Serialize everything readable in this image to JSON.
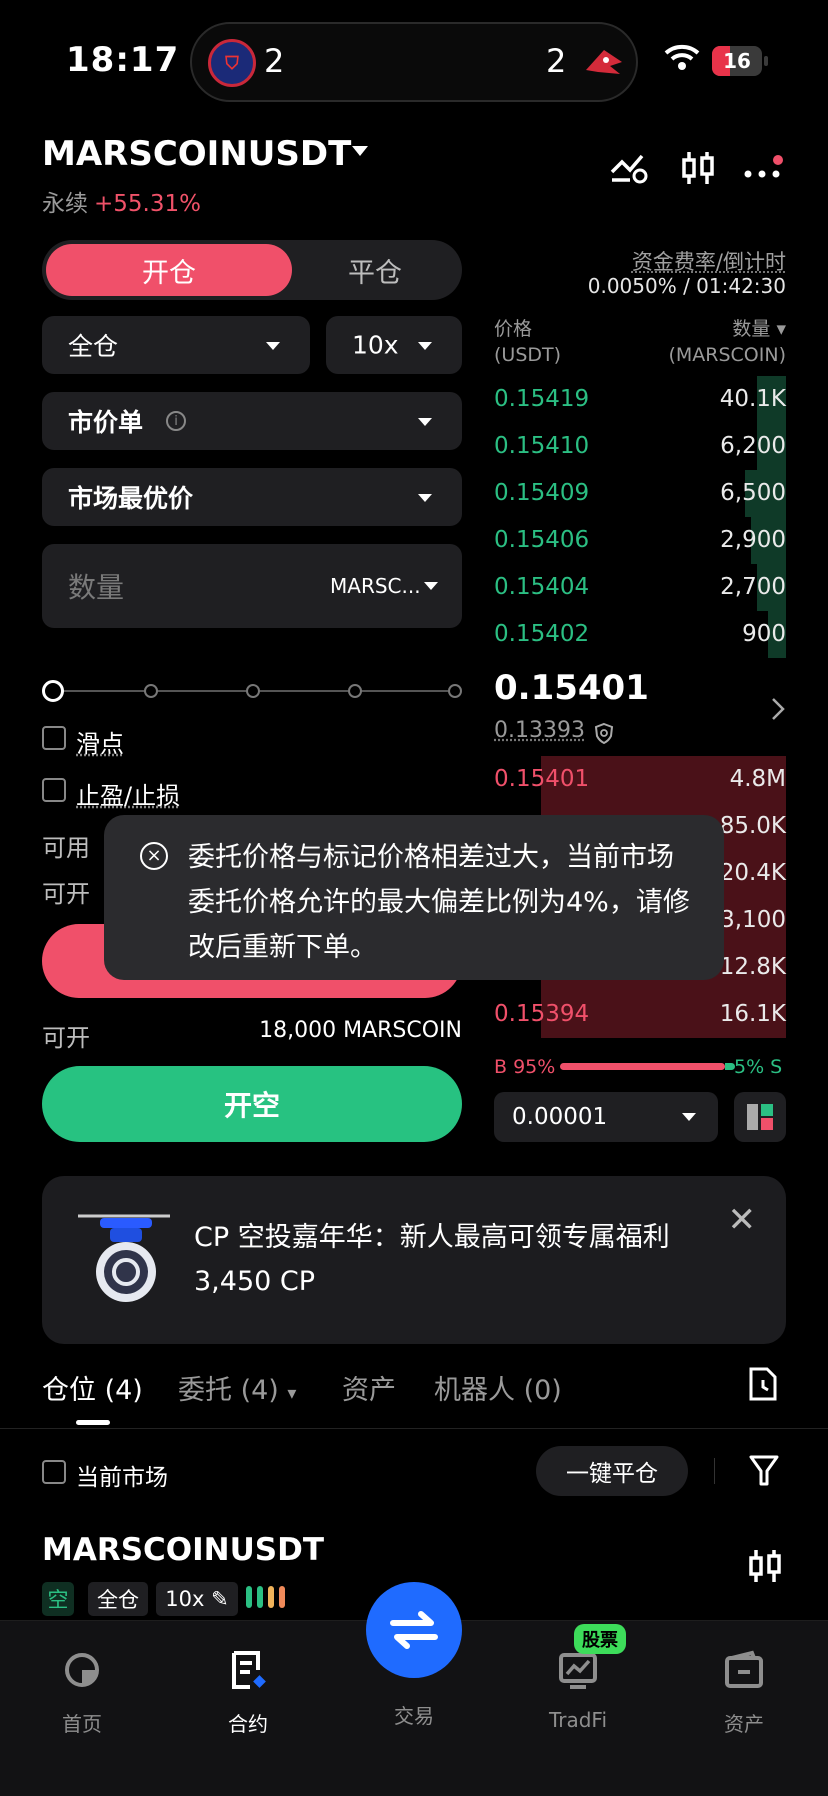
{
  "status": {
    "time": "18:17",
    "island_left_count": "2",
    "island_right_count": "2",
    "battery": "16"
  },
  "header": {
    "pair": "MARSCOINUSDT",
    "type": "永续",
    "change": "+55.31%"
  },
  "tabs": {
    "open": "开仓",
    "close": "平仓"
  },
  "form": {
    "margin_mode": "全仓",
    "leverage": "10x",
    "order_type": "市价单",
    "price_type": "市场最优价",
    "qty_placeholder": "数量",
    "qty_unit": "MARSC...",
    "slippage": "滑点",
    "tpsl": "止盈/止损",
    "available_label": "可用",
    "can_open_label": "可开",
    "can_open_label2": "可开",
    "can_open_value": "18,000 MARSCOIN",
    "short_button": "开空"
  },
  "funding": {
    "label": "资金费率/倒计时",
    "value": "0.0050% / 01:42:30"
  },
  "orderbook": {
    "price_header": "价格",
    "price_unit": "(USDT)",
    "qty_header": "数量",
    "qty_unit": "(MARSCOIN)",
    "asks": [
      {
        "price": "0.15419",
        "qty": "40.1K",
        "depth": 0.1
      },
      {
        "price": "0.15410",
        "qty": "6,200",
        "depth": 0.1
      },
      {
        "price": "0.15409",
        "qty": "6,500",
        "depth": 0.14
      },
      {
        "price": "0.15406",
        "qty": "2,900",
        "depth": 0.12
      },
      {
        "price": "0.15404",
        "qty": "2,700",
        "depth": 0.1
      },
      {
        "price": "0.15402",
        "qty": "900",
        "depth": 0.06
      }
    ],
    "last_price": "0.15401",
    "mark_price": "0.13393",
    "bids": [
      {
        "price": "0.15401",
        "qty": "4.8M",
        "depth": 0.84
      },
      {
        "price": "",
        "qty": "85.0K",
        "depth": 0.84
      },
      {
        "price": "",
        "qty": "20.4K",
        "depth": 0.84
      },
      {
        "price": "",
        "qty": "3,100",
        "depth": 0.84
      },
      {
        "price": "",
        "qty": "12.8K",
        "depth": 0.84
      },
      {
        "price": "0.15394",
        "qty": "16.1K",
        "depth": 0.84
      }
    ],
    "buy_ratio": "B 95%",
    "sell_ratio": "5% S",
    "precision": "0.00001"
  },
  "toast": {
    "message": "委托价格与标记价格相差过大，当前市场委托价格允许的最大偏差比例为4%，请修改后重新下单。"
  },
  "promo": {
    "text": "CP 空投嘉年华：新人最高可领专属福利 3,450 CP"
  },
  "bottom_tabs": {
    "positions": "仓位 (4)",
    "orders": "委托 (4)",
    "assets": "资产",
    "bots": "机器人 (0)"
  },
  "positions": {
    "current_market": "当前市场",
    "close_all": "一键平仓",
    "pair": "MARSCOINUSDT",
    "side_tag": "空",
    "mode_tag": "全仓",
    "lev_tag": "10x"
  },
  "tabbar": {
    "home": "首页",
    "futures": "合约",
    "trade": "交易",
    "tradfi": "TradFi",
    "stock_badge": "股票",
    "assets": "资产"
  },
  "colors": {
    "up": "#2bbf83",
    "down": "#f0506a",
    "accent": "#1f6bff"
  }
}
